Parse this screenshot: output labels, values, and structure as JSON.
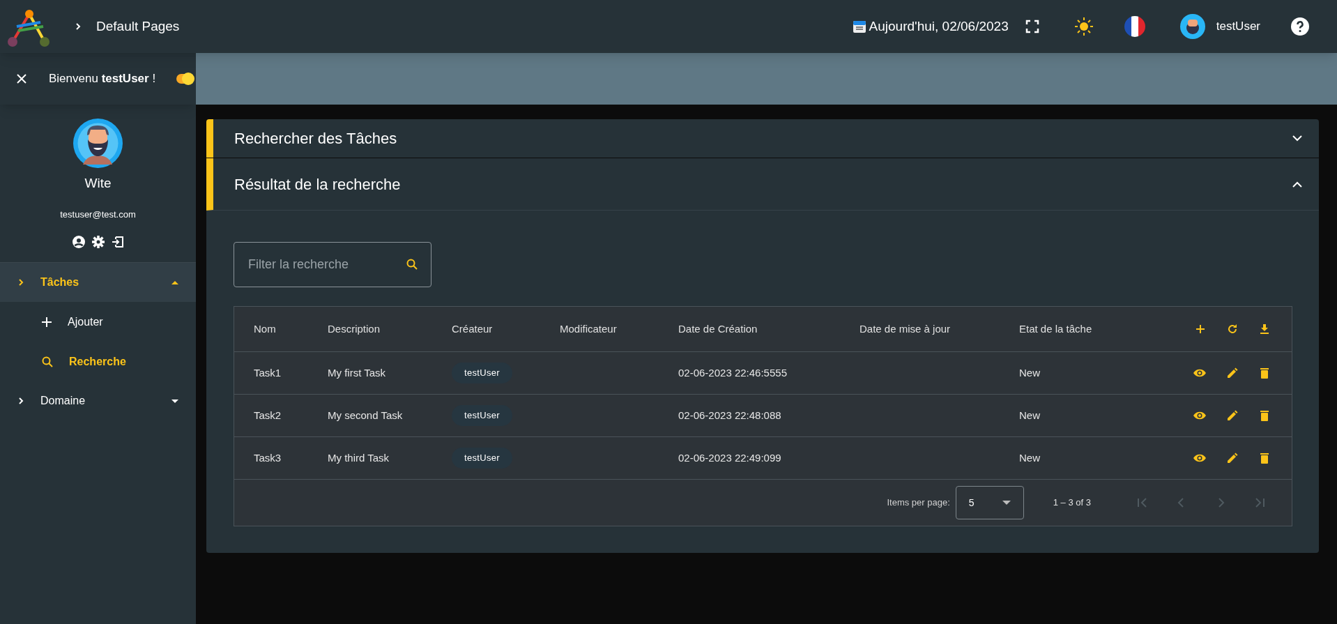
{
  "topbar": {
    "breadcrumb": "Default Pages",
    "date": "Aujourd'hui, 02/06/2023",
    "user": "testUser"
  },
  "sidebar": {
    "greeting": "Bienvenu **testUser** !",
    "theme_toggle": {
      "on": true
    },
    "profile": {
      "name": "Wite",
      "email": "testuser@test.com"
    },
    "items": [
      {
        "label": "Tâches",
        "expanded": true,
        "selected": true,
        "children": [
          {
            "label": "Ajouter",
            "kind": "add",
            "selected": false
          },
          {
            "label": "Recherche",
            "kind": "search",
            "selected": true
          }
        ]
      },
      {
        "label": "Domaine",
        "expanded": false,
        "selected": false
      }
    ]
  },
  "panels": [
    {
      "title": "Rechercher des Tâches",
      "expanded": false
    },
    {
      "title": "Résultat de la recherche",
      "expanded": true
    }
  ],
  "filter": {
    "placeholder": "Filter la recherche"
  },
  "table": {
    "columns": [
      "Nom",
      "Description",
      "Créateur",
      "Modificateur",
      "Date de Création",
      "Date de mise à jour",
      "Etat de la tâche"
    ],
    "rows": [
      {
        "name": "Task1",
        "description": "My first Task",
        "creator": "testUser",
        "created": "02-06-2023 22:46:5555",
        "state": "New"
      },
      {
        "name": "Task2",
        "description": "My second Task",
        "creator": "testUser",
        "created": "02-06-2023 22:48:088",
        "state": "New"
      },
      {
        "name": "Task3",
        "description": "My third Task",
        "creator": "testUser",
        "created": "02-06-2023 22:49:099",
        "state": "New"
      }
    ]
  },
  "paginator": {
    "label": "Items per page:",
    "page_size": "5",
    "range": "1 – 3 of 3",
    "buttons": [
      {
        "kind": "first",
        "disabled": true
      },
      {
        "kind": "prev",
        "disabled": true
      },
      {
        "kind": "next",
        "disabled": true
      },
      {
        "kind": "last",
        "disabled": true
      }
    ]
  }
}
